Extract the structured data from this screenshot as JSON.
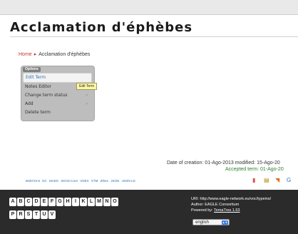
{
  "header": {
    "title": "Acclamation d'éphèbes"
  },
  "breadcrumb": {
    "home": "Home",
    "separator": "▸",
    "current": "Acclamation d'éphèbes"
  },
  "options": {
    "tab_label": "Options",
    "items": [
      {
        "label": "Edit Term",
        "has_submenu": false,
        "active": true
      },
      {
        "label": "Notes Editor",
        "has_submenu": false,
        "active": false
      },
      {
        "label": "Change term status",
        "has_submenu": true,
        "active": false
      },
      {
        "label": "Add",
        "has_submenu": true,
        "active": false
      },
      {
        "label": "Delete term",
        "has_submenu": false,
        "active": false
      }
    ],
    "submenu_arrow": "›",
    "tooltip": "Edit Term"
  },
  "meta": {
    "date_line": "Date of creation: 01-Ago-2013 modified: 15-Ago-20",
    "accepted_line": "Accepted term: 01-Ago-20"
  },
  "formats": [
    "BS8723-5",
    "DC",
    "MADS",
    "SKOS-Core",
    "VDEX",
    "XTM",
    "Zthes",
    "JSON",
    "JSON-LD"
  ],
  "footer": {
    "letters_row1": [
      "A",
      "B",
      "C",
      "D",
      "E",
      "F",
      "G",
      "H",
      "I",
      "K",
      "L",
      "M",
      "N",
      "O"
    ],
    "letters_row2": [
      "P",
      "R",
      "S",
      "T",
      "U",
      "V"
    ],
    "uri": "URI: http://www.eagle-network.eu/voc/typeins/",
    "author": "Author: EAGLE Consortium",
    "powered_prefix": "Powered by: ",
    "powered_link": "TemaTres 1.63",
    "language": "english"
  },
  "colors": {
    "link_red": "#c0392b",
    "link_blue": "#2a6fb3",
    "accepted_green": "#2f7d2f",
    "footer_bg": "#2b2b2b",
    "tooltip_bg": "#fff7a8"
  }
}
